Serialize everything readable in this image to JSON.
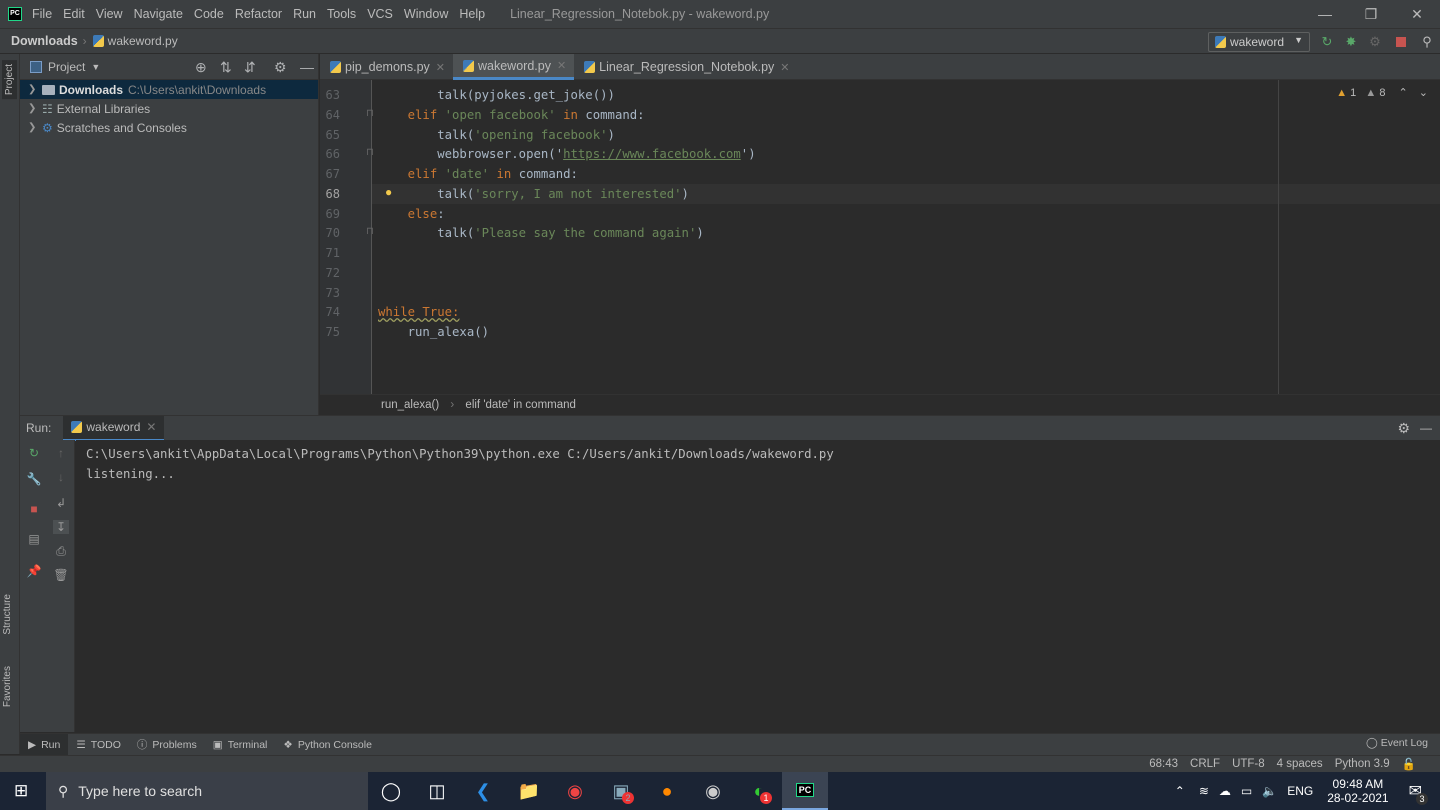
{
  "titlebar": {
    "menu": [
      "File",
      "Edit",
      "View",
      "Navigate",
      "Code",
      "Refactor",
      "Run",
      "Tools",
      "VCS",
      "Window",
      "Help"
    ],
    "title": "Linear_Regression_Notebok.py - wakeword.py"
  },
  "navbar": {
    "breadcrumb_root": "Downloads",
    "breadcrumb_file": "wakeword.py",
    "run_config": "wakeword"
  },
  "project": {
    "header": "Project",
    "side_tab": "Project",
    "items": [
      {
        "label": "Downloads",
        "path": "C:\\Users\\ankit\\Downloads"
      },
      {
        "label": "External Libraries"
      },
      {
        "label": "Scratches and Consoles"
      }
    ]
  },
  "editor": {
    "tabs": [
      "pip_demons.py",
      "wakeword.py",
      "Linear_Regression_Notebok.py"
    ],
    "active_tab": 1,
    "inspections": {
      "errors": "1",
      "warnings": "8"
    },
    "current_line": 68,
    "lines": [
      {
        "n": "63",
        "tokens": [
          [
            "        talk(pyjokes.get_joke())",
            ""
          ]
        ]
      },
      {
        "n": "64",
        "tokens": [
          [
            "    ",
            ""
          ],
          [
            "elif",
            "kw"
          ],
          [
            " ",
            ""
          ],
          [
            "'open facebook'",
            "str"
          ],
          [
            " ",
            ""
          ],
          [
            "in",
            "kw"
          ],
          [
            " command:",
            ""
          ]
        ]
      },
      {
        "n": "65",
        "tokens": [
          [
            "        talk(",
            ""
          ],
          [
            "'opening facebook'",
            "str"
          ],
          [
            ")",
            ""
          ]
        ]
      },
      {
        "n": "66",
        "tokens": [
          [
            "        webbrowser.open(",
            ""
          ],
          [
            "'",
            ""
          ],
          [
            "https://www.facebook.com",
            "url"
          ],
          [
            "'",
            ""
          ],
          [
            ")",
            ""
          ]
        ]
      },
      {
        "n": "67",
        "tokens": [
          [
            "    ",
            ""
          ],
          [
            "elif",
            "kw"
          ],
          [
            " ",
            ""
          ],
          [
            "'date'",
            "str"
          ],
          [
            " ",
            ""
          ],
          [
            "in",
            "kw"
          ],
          [
            " command:",
            ""
          ]
        ]
      },
      {
        "n": "68",
        "tokens": [
          [
            "        talk(",
            ""
          ],
          [
            "'sorry, I am not interested'",
            "str"
          ],
          [
            ")",
            ""
          ]
        ]
      },
      {
        "n": "69",
        "tokens": [
          [
            "    ",
            ""
          ],
          [
            "else",
            "kw"
          ],
          [
            ":",
            ""
          ]
        ]
      },
      {
        "n": "70",
        "tokens": [
          [
            "        talk(",
            ""
          ],
          [
            "'Please say the command again'",
            "str"
          ],
          [
            ")",
            ""
          ]
        ]
      },
      {
        "n": "71",
        "tokens": []
      },
      {
        "n": "72",
        "tokens": []
      },
      {
        "n": "73",
        "tokens": []
      },
      {
        "n": "74",
        "tokens": [
          [
            "while True:",
            "warn"
          ]
        ]
      },
      {
        "n": "75",
        "tokens": [
          [
            "    run_alexa()",
            ""
          ]
        ]
      }
    ],
    "breadcrumbs": [
      "run_alexa()",
      "elif 'date' in command"
    ]
  },
  "run": {
    "label": "Run:",
    "tab": "wakeword",
    "output": [
      "C:\\Users\\ankit\\AppData\\Local\\Programs\\Python\\Python39\\python.exe C:/Users/ankit/Downloads/wakeword.py",
      "listening..."
    ]
  },
  "bottom_tabs": [
    "Run",
    "TODO",
    "Problems",
    "Terminal",
    "Python Console"
  ],
  "side_tabs": {
    "structure": "Structure",
    "favorites": "Favorites"
  },
  "event_log": "Event Log",
  "status": {
    "position": "68:43",
    "line_sep": "CRLF",
    "encoding": "UTF-8",
    "indent": "4 spaces",
    "interpreter": "Python 3.9"
  },
  "taskbar": {
    "search_placeholder": "Type here to search",
    "lang": "ENG",
    "time": "09:48 AM",
    "date": "28-02-2021",
    "notifications": "3",
    "badges": {
      "app2": "2",
      "whatsapp": "1"
    }
  }
}
